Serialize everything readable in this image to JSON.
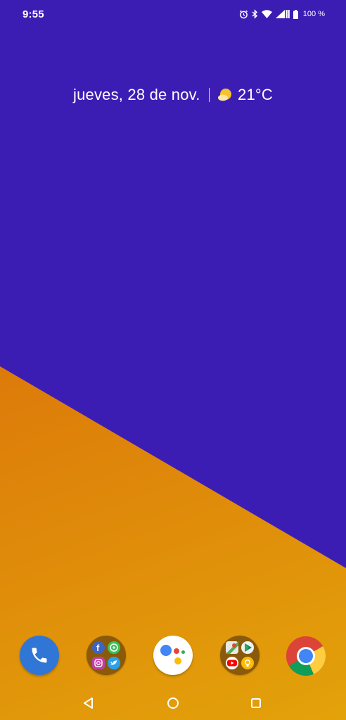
{
  "status_bar": {
    "time": "9:55",
    "battery": "100 %",
    "icons": [
      "alarm-icon",
      "bluetooth-icon",
      "wifi-icon",
      "signal-icon",
      "battery-icon"
    ]
  },
  "glance": {
    "date": "jueves, 28 de nov.",
    "temperature": "21°C",
    "weather_icon": "partly-sunny-icon"
  },
  "colors": {
    "wallpaper_top": "#3c1db4",
    "wallpaper_bottom": "#dc780a"
  },
  "dock": {
    "apps": [
      {
        "name": "phone",
        "icon": "phone-icon"
      },
      {
        "name": "social-folder",
        "icons": [
          "facebook-icon",
          "whatsapp-icon",
          "instagram-icon",
          "twitter-icon"
        ]
      },
      {
        "name": "assistant",
        "icon": "google-assistant-icon"
      },
      {
        "name": "google-folder",
        "icons": [
          "maps-icon",
          "play-store-icon",
          "youtube-icon",
          "keep-icon"
        ]
      },
      {
        "name": "chrome",
        "icon": "chrome-icon"
      }
    ]
  },
  "nav_bar": {
    "buttons": [
      "back-icon",
      "home-icon",
      "recents-icon"
    ]
  }
}
